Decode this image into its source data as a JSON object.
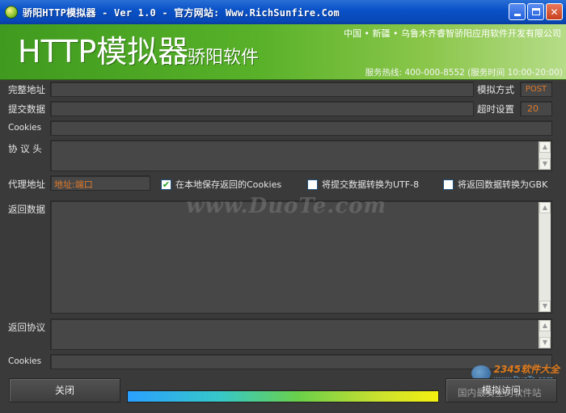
{
  "window": {
    "title": "骄阳HTTP模拟器 - Ver 1.0 - 官方网站: Www.RichSunfire.Com",
    "min_icon": "minimize-icon",
    "max_icon": "maximize-icon",
    "close_label": "✕"
  },
  "banner": {
    "title": "HTTP模拟器",
    "subtitle": "骄阳软件",
    "company": "中国 • 新疆 • 乌鲁木齐睿智骄阳应用软件开发有限公司",
    "hotline": "服务热线: 400-000-8552 (服务时间 10:00-20:00)"
  },
  "form": {
    "url_label": "完整地址",
    "url_value": "",
    "method_label": "模拟方式",
    "method_value": "POST",
    "post_label": "提交数据",
    "post_value": "",
    "timeout_label": "超时设置",
    "timeout_value": "20",
    "cookies_label": "Cookies",
    "cookies_value": "",
    "headers_label": "协 议 头",
    "headers_value": "",
    "proxy_label": "代理地址",
    "proxy_value": "地址:端口",
    "save_cookies_label": "在本地保存返回的Cookies",
    "save_cookies_checked": true,
    "utf8_label": "将提交数据转换为UTF-8",
    "utf8_checked": false,
    "gbk_label": "将返回数据转换为GBK",
    "gbk_checked": false,
    "response_label": "返回数据",
    "response_value": "",
    "resp_headers_label": "返回协议",
    "resp_headers_value": "",
    "resp_cookies_label": "Cookies",
    "resp_cookies_value": ""
  },
  "footer": {
    "close_button": "关闭",
    "simulate_button": "模拟访问",
    "progress": 1.0
  },
  "watermarks": {
    "main": "www.DuoTe.com",
    "logo_text": "2345软件大全",
    "logo_url": "www.DuoTe.com",
    "bottom": "国内最安全的软件站"
  }
}
